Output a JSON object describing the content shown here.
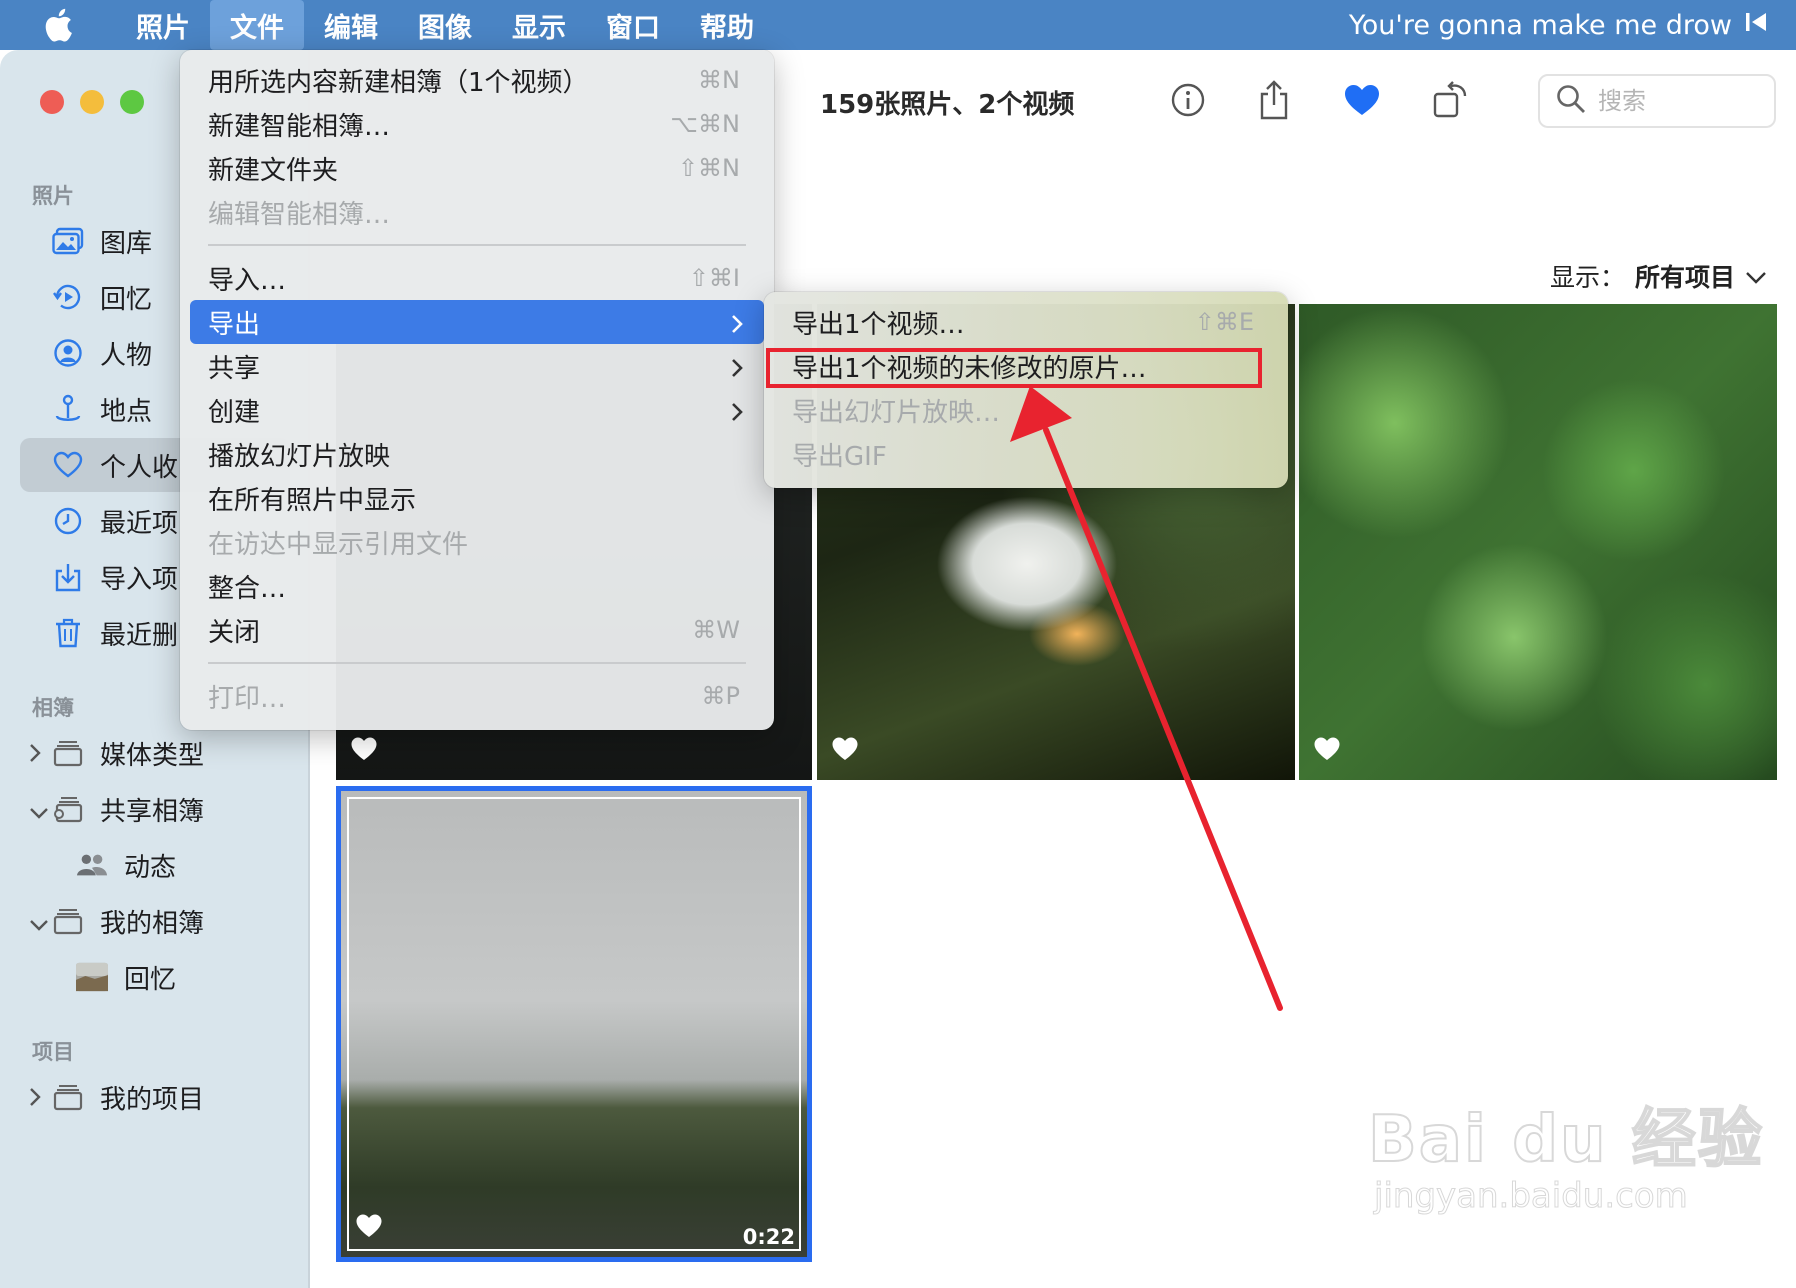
{
  "menubar": {
    "items": [
      "照片",
      "文件",
      "编辑",
      "图像",
      "显示",
      "窗口",
      "帮助"
    ],
    "active_index": 1,
    "now_playing": "You're gonna make me drow"
  },
  "toolbar": {
    "title": "159张照片、2个视频",
    "search_placeholder": "搜索"
  },
  "filter": {
    "label": "显示：",
    "value": "所有项目"
  },
  "sidebar": {
    "section_photos": "照片",
    "library": "图库",
    "memories": "回忆",
    "people": "人物",
    "places": "地点",
    "favorites": "个人收",
    "recents": "最近项",
    "imports": "导入项",
    "recently_deleted": "最近删",
    "section_albums": "相簿",
    "media_types": "媒体类型",
    "shared_albums": "共享相簿",
    "activity": "动态",
    "my_albums": "我的相簿",
    "memories_album": "回忆",
    "section_projects": "项目",
    "my_projects": "我的项目"
  },
  "file_menu": {
    "new_album": {
      "label": "用所选内容新建相簿（1个视频）",
      "shortcut": "⌘N"
    },
    "new_smart_album": {
      "label": "新建智能相簿…",
      "shortcut": "⌥⌘N"
    },
    "new_folder": {
      "label": "新建文件夹",
      "shortcut": "⇧⌘N"
    },
    "edit_smart_album": {
      "label": "编辑智能相簿…"
    },
    "import": {
      "label": "导入…",
      "shortcut": "⇧⌘I"
    },
    "export": {
      "label": "导出"
    },
    "share": {
      "label": "共享"
    },
    "create": {
      "label": "创建"
    },
    "slideshow": {
      "label": "播放幻灯片放映"
    },
    "show_in_all": {
      "label": "在所有照片中显示"
    },
    "show_in_finder": {
      "label": "在访达中显示引用文件"
    },
    "consolidate": {
      "label": "整合…"
    },
    "close": {
      "label": "关闭",
      "shortcut": "⌘W"
    },
    "print": {
      "label": "打印…",
      "shortcut": "⌘P"
    }
  },
  "export_submenu": {
    "export_video": {
      "label": "导出1个视频…",
      "shortcut": "⇧⌘E"
    },
    "export_original": {
      "label": "导出1个视频的未修改的原片…"
    },
    "export_slideshow": {
      "label": "导出幻灯片放映…"
    },
    "export_gif": {
      "label": "导出GIF"
    }
  },
  "photos": {
    "video_duration": "0:22"
  },
  "watermark": {
    "brand": "Bai du 经验",
    "url": "jingyan.baidu.com"
  },
  "colors": {
    "menubar": "#4a84c4",
    "highlight": "#3d7be6",
    "annotation": "#e8232f",
    "favorite": "#1f6ef5",
    "selection": "#2a6cf0"
  }
}
